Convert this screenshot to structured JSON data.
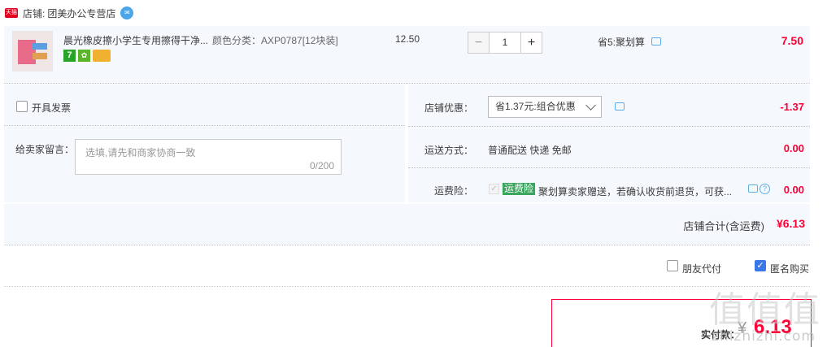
{
  "shop": {
    "badge": "天猫",
    "label": "店铺:",
    "name": "团美办公专营店",
    "ww_icon": "wangwang-icon"
  },
  "item": {
    "title": "晨光橡皮擦小学生专用擦得干净...",
    "sku": "颜色分类：AXP0787[12块装]",
    "icon_7": "7",
    "unit_price": "12.50",
    "qty_minus": "−",
    "qty_value": "1",
    "qty_plus": "+",
    "promo": "省5:聚划算",
    "total": "7.50"
  },
  "invoice": {
    "label": "开具发票"
  },
  "message": {
    "label": "给卖家留言：",
    "placeholder": "选填,请先和商家协商一致",
    "count": "0/200"
  },
  "shop_discount": {
    "label": "店铺优惠：",
    "selected": "省1.37元:组合优惠",
    "value": "-1.37"
  },
  "shipping": {
    "label": "运送方式：",
    "text": "普通配送 快递 免邮",
    "value": "0.00"
  },
  "insurance": {
    "label": "运费险：",
    "tag": "运费险",
    "text": "聚划算卖家赠送，若确认收货前退货，可获...",
    "value": "0.00"
  },
  "summary": {
    "label": "店铺合计(含运费)",
    "value": "¥6.13"
  },
  "options": {
    "friend_pay": "朋友代付",
    "anonymous": "匿名购买",
    "anonymous_checked": true
  },
  "payment": {
    "label": "实付款：",
    "currency": "¥",
    "value": "6.13"
  },
  "watermark": {
    "logo": "值值值",
    "url": "zhizhizhi.com"
  },
  "colors": {
    "accent": "#ff0036",
    "panel_bg": "#f5f8fd",
    "check_blue": "#3b78e7",
    "insurance_green": "#3aa55c"
  }
}
